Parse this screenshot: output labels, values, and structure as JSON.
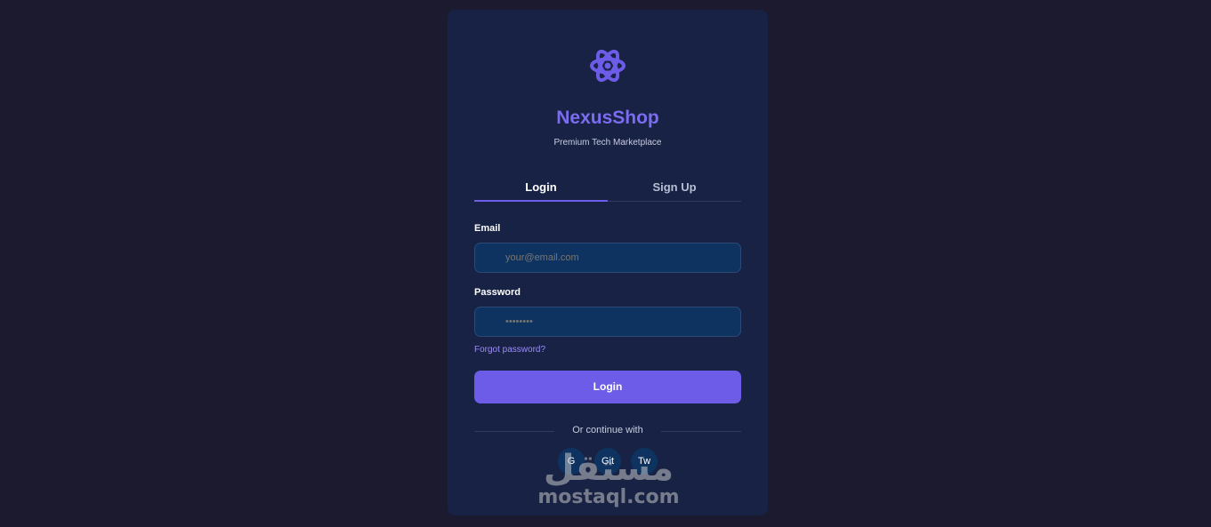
{
  "brand": {
    "name": "NexusShop",
    "tagline": "Premium Tech Marketplace",
    "logo_icon": "atom-icon",
    "accent_color": "#6c5ce7"
  },
  "tabs": [
    {
      "label": "Login",
      "active": true
    },
    {
      "label": "Sign Up",
      "active": false
    }
  ],
  "form": {
    "email_label": "Email",
    "email_placeholder": "your@email.com",
    "password_label": "Password",
    "password_placeholder": "••••••••",
    "forgot_link": "Forgot password?",
    "submit_label": "Login"
  },
  "social": {
    "divider_text": "Or continue with",
    "buttons": [
      "G",
      "Git",
      "Tw"
    ]
  },
  "watermark": {
    "arabic": "مستقل",
    "latin": "mostaql.com"
  }
}
